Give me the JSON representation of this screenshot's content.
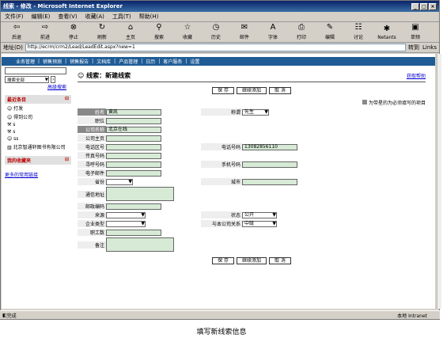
{
  "window": {
    "title": "线索 - 修改 - Microsoft Internet Explorer"
  },
  "menu": [
    "文件(F)",
    "编辑(E)",
    "查看(V)",
    "收藏(A)",
    "工具(T)",
    "帮助(H)"
  ],
  "toolbar": [
    "后退",
    "前进",
    "停止",
    "刷新",
    "主页",
    "搜索",
    "收藏",
    "历史",
    "邮件",
    "字体",
    "打印",
    "编辑",
    "讨论",
    "Netants",
    "单频"
  ],
  "address": {
    "label": "地址(D)",
    "url": "http://ecrm/crm2/Lead/LeadEdit.aspx?new=1",
    "go": "转到",
    "links": "Links"
  },
  "nav": [
    "业务管理",
    "销售预测",
    "销售报告",
    "文档库",
    "产品管理",
    "日历",
    "客户服务",
    "设置"
  ],
  "sidebar": {
    "select": "搜索全部",
    "adv": "高级搜索",
    "recent_title": "最近条目",
    "recent": [
      "打发",
      "得到公司",
      "s",
      "s",
      "ss",
      "北京智通轩图书有限公司"
    ],
    "fav_title": "我的收藏夹",
    "more": "更多的常用链接"
  },
  "main": {
    "title": "线索：新建线索",
    "help": "获取帮助",
    "required_note": "为带星的为必须填写的项目",
    "save": "保 存",
    "save_add": "继续添加",
    "cancel": "取 消"
  },
  "fields": {
    "surname": "姓名",
    "surname_val": "黄凯",
    "title": "称谓",
    "title_val": "先生",
    "position": "职位",
    "company": "公司名称",
    "company_val": "北京在线",
    "company_owner": "公司主页",
    "area_code": "电话区号",
    "phone": "电话号码",
    "phone_val": "13082856110",
    "fax": "传真号码",
    "mobile": "手机号码",
    "pager": "寻呼号码",
    "email": "电子邮件",
    "province": "省份",
    "city": "城市",
    "address": "通信地址",
    "zip": "邮政编码",
    "source": "来源",
    "status": "状态",
    "status_val": "公开",
    "industry": "企业类型",
    "relation": "与本公司关系",
    "relation_val": "中级",
    "employees": "职工数",
    "remark": "备注"
  },
  "status": {
    "left": "完成",
    "right": "本地 Intranet"
  },
  "caption": "填写新线索信息"
}
